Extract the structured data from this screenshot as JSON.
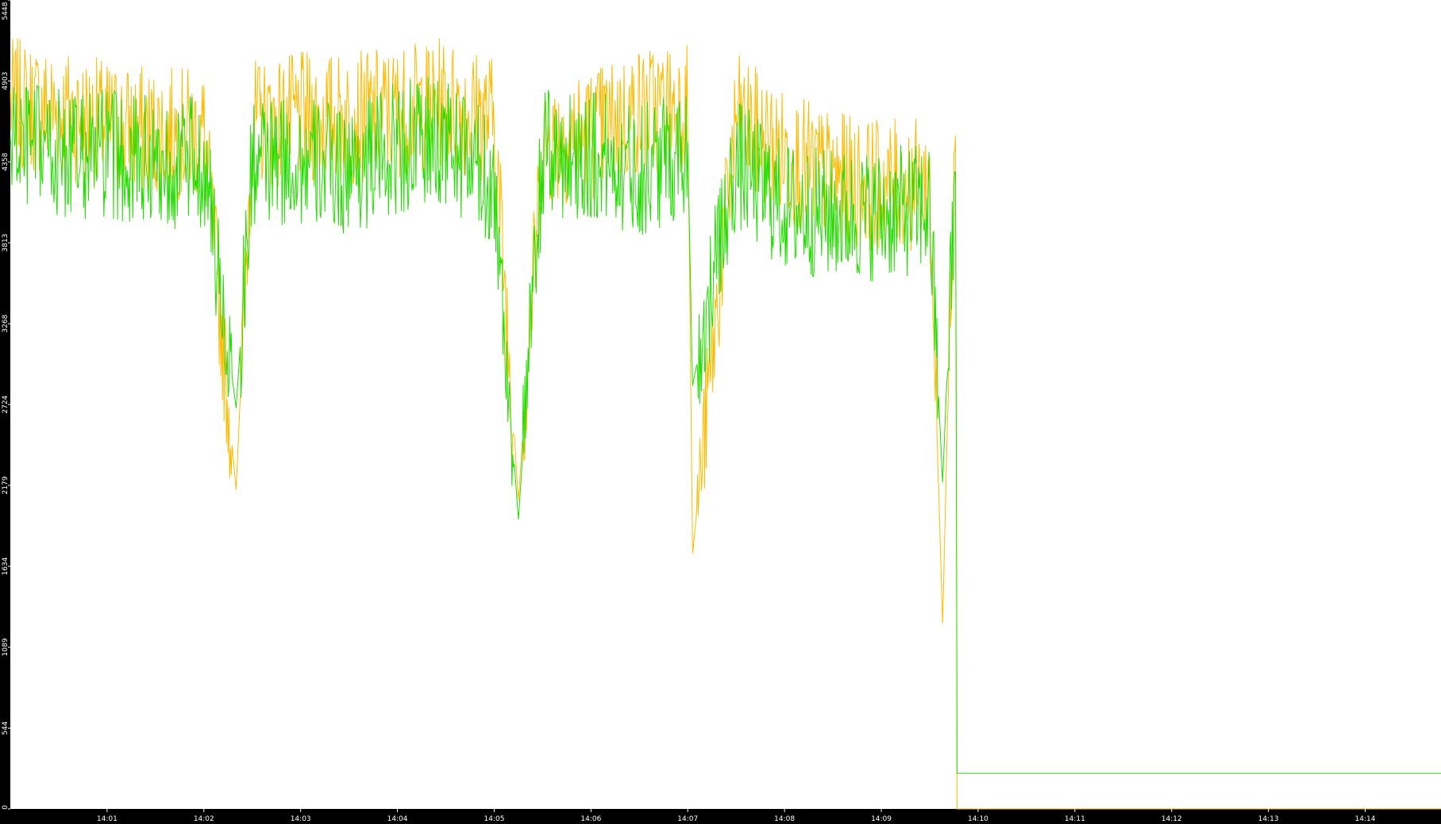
{
  "chart_data": {
    "type": "line",
    "title": "",
    "xlabel": "",
    "ylabel": "",
    "background_color": "#000000",
    "plot_background_color": "#ffffff",
    "grid": false,
    "legend": "none",
    "y_ticks": [
      0,
      544,
      1089,
      1634,
      2179,
      2724,
      3268,
      3813,
      4358,
      4903,
      5448
    ],
    "y_tick_labels": [
      "0",
      "544",
      "1089",
      "1634",
      "2179",
      "2724",
      "3268",
      "3813",
      "4358",
      "4903",
      "5448"
    ],
    "ylim": [
      0,
      5448
    ],
    "x_tick_labels": [
      "14:01",
      "14:02",
      "14:03",
      "14:04",
      "14:05",
      "14:06",
      "14:07",
      "14:08",
      "14:09",
      "14:10",
      "14:11",
      "14:12",
      "14:13",
      "14:14"
    ],
    "xlim": [
      "14:00:00",
      "14:14:47"
    ],
    "series": [
      {
        "color": "#ffbb00",
        "time": [
          "14:00:00",
          "14:00:30",
          "14:01:00",
          "14:01:30",
          "14:02:00",
          "14:02:20",
          "14:02:30",
          "14:03:00",
          "14:03:30",
          "14:04:00",
          "14:04:30",
          "14:05:00",
          "14:05:15",
          "14:05:30",
          "14:06:00",
          "14:06:30",
          "14:07:00",
          "14:07:03",
          "14:07:30",
          "14:08:00",
          "14:08:30",
          "14:09:00",
          "14:09:30",
          "14:09:38",
          "14:09:46",
          "14:09:47",
          "14:14:47"
        ],
        "values": [
          4750,
          4700,
          4600,
          4550,
          4550,
          2150,
          4600,
          4650,
          4650,
          4700,
          4750,
          4650,
          2080,
          4500,
          4550,
          4700,
          4750,
          1720,
          4650,
          4400,
          4250,
          4200,
          4200,
          1250,
          4850,
          0,
          0
        ]
      },
      {
        "color": "#22dd00",
        "time": [
          "14:00:00",
          "14:00:30",
          "14:01:00",
          "14:01:30",
          "14:02:00",
          "14:02:20",
          "14:02:30",
          "14:03:00",
          "14:03:30",
          "14:04:00",
          "14:04:30",
          "14:05:00",
          "14:05:15",
          "14:05:30",
          "14:06:00",
          "14:06:30",
          "14:07:00",
          "14:07:03",
          "14:07:30",
          "14:08:00",
          "14:08:30",
          "14:09:00",
          "14:09:30",
          "14:09:38",
          "14:09:46",
          "14:09:47",
          "14:14:47"
        ],
        "values": [
          4500,
          4400,
          4400,
          4350,
          4350,
          2700,
          4350,
          4350,
          4300,
          4450,
          4500,
          4200,
          1950,
          4400,
          4400,
          4300,
          4450,
          2850,
          4350,
          4050,
          4000,
          4000,
          4050,
          2200,
          4300,
          240,
          240
        ]
      }
    ]
  }
}
